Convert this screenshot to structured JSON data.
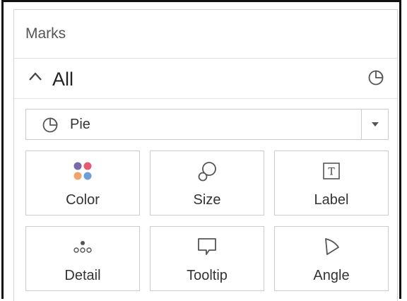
{
  "panel": {
    "title": "Marks"
  },
  "all_section": {
    "label": "All",
    "expand_icon": "chevron-up-icon",
    "type_icon": "pie-chart-icon"
  },
  "mark_type": {
    "value": "Pie",
    "icon": "pie-chart-icon",
    "dropdown_icon": "caret-down-icon"
  },
  "cards": {
    "color": {
      "label": "Color",
      "icon": "color-dots-icon",
      "colors": [
        "#7b6aa8",
        "#e85a73",
        "#f0a36e",
        "#6d9fd4"
      ]
    },
    "size": {
      "label": "Size",
      "icon": "size-shapes-icon"
    },
    "label": {
      "label": "Label",
      "icon": "text-box-icon",
      "glyph": "T"
    },
    "detail": {
      "label": "Detail",
      "icon": "detail-dots-icon"
    },
    "tooltip": {
      "label": "Tooltip",
      "icon": "speech-bubble-icon"
    },
    "angle": {
      "label": "Angle",
      "icon": "angle-wedge-icon"
    }
  }
}
